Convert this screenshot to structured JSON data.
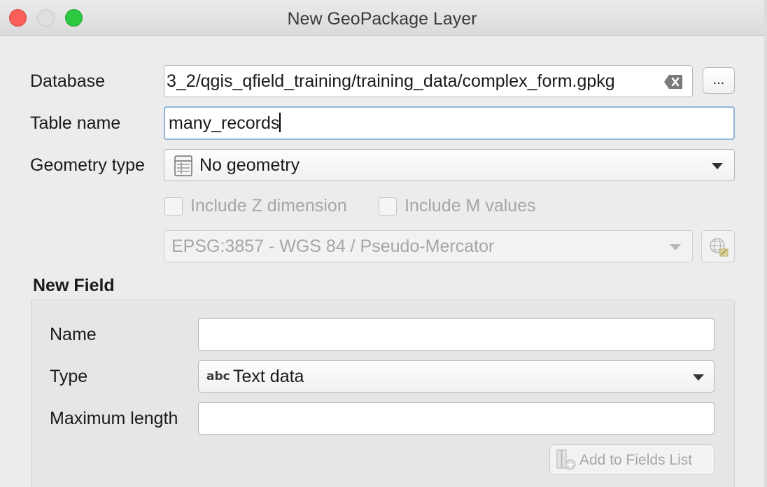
{
  "window": {
    "title": "New GeoPackage Layer"
  },
  "form": {
    "database_label": "Database",
    "database_value": "3_2/qgis_qfield_training/training_data/complex_form.gpkg",
    "browse_label": "...",
    "table_name_label": "Table name",
    "table_name_value": "many_records",
    "geometry_type_label": "Geometry type",
    "geometry_type_value": "No geometry",
    "include_z_label": "Include Z dimension",
    "include_m_label": "Include M values",
    "crs_value": "EPSG:3857 - WGS 84 / Pseudo-Mercator"
  },
  "new_field": {
    "section_title": "New Field",
    "name_label": "Name",
    "name_value": "",
    "type_label": "Type",
    "type_icon_text": "abc",
    "type_value": "Text data",
    "max_length_label": "Maximum length",
    "max_length_value": "",
    "add_button_label": "Add to Fields List"
  },
  "state": {
    "include_z_checked": false,
    "include_m_checked": false
  },
  "icons": {
    "clear": "clear-text-icon",
    "table": "table-icon",
    "crs": "crs-globe-icon",
    "add_field": "add-field-icon"
  }
}
